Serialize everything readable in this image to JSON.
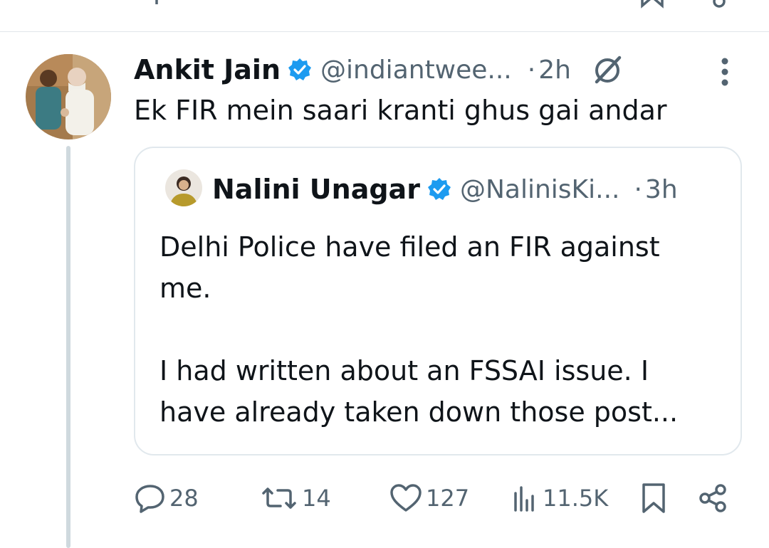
{
  "tweet": {
    "author_name": "Ankit Jain",
    "author_handle": "@indiantwee...",
    "separator": "·",
    "timestamp": "2h",
    "text": "Ek FIR mein saari kranti ghus gai andar",
    "verified_color": "#1d9bf0"
  },
  "quoted_tweet": {
    "author_name": "Nalini Unagar",
    "author_handle": "@NalinisKi...",
    "separator": "·",
    "timestamp": "3h",
    "paragraph_1": "Delhi Police have filed an FIR against me.",
    "paragraph_2": "I had written about an FSSAI issue. I have already taken down those post..."
  },
  "actions": {
    "replies": "28",
    "reposts": "14",
    "likes": "127",
    "views": "11.5K"
  },
  "icons": [
    "verified-badge-icon",
    "grok-icon",
    "more-icon",
    "reply-icon",
    "repost-icon",
    "like-icon",
    "views-icon",
    "bookmark-icon",
    "share-icon"
  ]
}
